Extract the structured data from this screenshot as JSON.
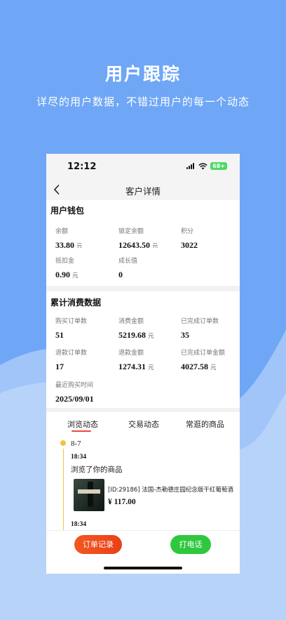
{
  "hero": {
    "title": "用户跟踪",
    "subtitle": "详尽的用户数据，不错过用户的每一个动态"
  },
  "status_bar": {
    "time": "12:12",
    "battery": "68+"
  },
  "nav": {
    "title": "客户详情",
    "back_icon": "chevron-left-icon"
  },
  "wallet": {
    "title": "用户钱包",
    "items": [
      {
        "label": "余额",
        "value": "33.80",
        "unit": "元"
      },
      {
        "label": "锁定余额",
        "value": "12643.50",
        "unit": "元"
      },
      {
        "label": "积分",
        "value": "3022",
        "unit": ""
      },
      {
        "label": "抵扣金",
        "value": "0.90",
        "unit": "元"
      },
      {
        "label": "成长值",
        "value": "0",
        "unit": ""
      }
    ]
  },
  "consumption": {
    "title": "累计消费数据",
    "items": [
      {
        "label": "购买订单数",
        "value": "51",
        "unit": ""
      },
      {
        "label": "消费金额",
        "value": "5219.68",
        "unit": "元"
      },
      {
        "label": "已完成订单数",
        "value": "35",
        "unit": ""
      },
      {
        "label": "退款订单数",
        "value": "17",
        "unit": ""
      },
      {
        "label": "退款金额",
        "value": "1274.31",
        "unit": "元"
      },
      {
        "label": "已完成订单金额",
        "value": "4027.58",
        "unit": "元"
      },
      {
        "label": "最近购买时间",
        "value": "2025/09/01",
        "unit": ""
      }
    ]
  },
  "tabs": [
    {
      "label": "浏览动态",
      "active": true
    },
    {
      "label": "交易动态",
      "active": false
    },
    {
      "label": "常逛的商品",
      "active": false
    }
  ],
  "timeline": {
    "date": "8-7",
    "entries": [
      {
        "time": "18:34",
        "text": "浏览了你的商品",
        "product": {
          "name": "[ID:29186] 法国-杰勒德庄园纪念版干红葡萄酒",
          "price": "¥ 117.00"
        }
      },
      {
        "time": "18:34"
      }
    ]
  },
  "actions": {
    "orders_label": "订单记录",
    "call_label": "打电话"
  },
  "colors": {
    "background": "#6FA7F6",
    "accent_red": "#E8411A",
    "accent_green": "#2EC83F",
    "timeline_yellow": "#F1C43F"
  }
}
